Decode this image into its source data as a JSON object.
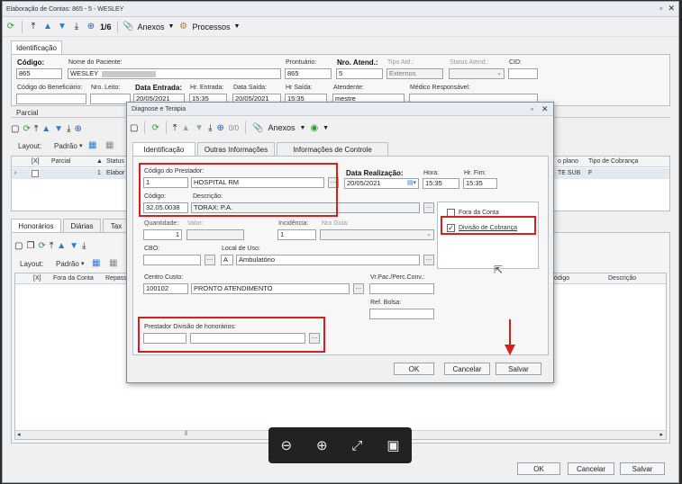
{
  "main": {
    "title": "Elaboração de Contas: 865 - 5 - WESLEY",
    "pager": "1/6",
    "anexos": "Anexos",
    "processos": "Processos",
    "tab_identificacao": "Identificação",
    "codigo_label": "Código:",
    "codigo_value": "865",
    "nome_label": "Nome do Paciente:",
    "nome_value": "WESLEY",
    "prontuario_label": "Prontuário:",
    "prontuario_value": "865",
    "nro_atend_label": "Nro. Atend.:",
    "nro_atend_value": "5",
    "tipo_atd_label": "Tipo Atd.:",
    "tipo_atd_value": "Externos",
    "status_atend_label": "Status Atend.:",
    "cid_label": "CID:",
    "cod_benef_label": "Código do Beneficiário:",
    "nro_leito_label": "Nro. Leito:",
    "data_entrada_label": "Data Entrada:",
    "data_entrada_value": "20/05/2021",
    "hr_entrada_label": "Hr. Entrada:",
    "hr_entrada_value": "15:35",
    "data_saida_label": "Data Saída:",
    "data_saida_value": "20/05/2021",
    "hr_saida_label": "Hr Saída:",
    "hr_saida_value": "15:35",
    "atendente_label": "Atendente:",
    "atendente_value": "mestre",
    "medico_label": "Médico Responsável:",
    "parcial_label": "Parcial",
    "layout_label": "Layout:",
    "padrao_label": "Padrão",
    "grid1": {
      "col_x": "[X]",
      "col_parcial": "Parcial",
      "col_status": "Status",
      "row_num": "1",
      "row_status": "Elabor"
    },
    "right_grid": {
      "col_plano": "o plano",
      "col_tipo": "Tipo de Cobrança",
      "row_plano": "TE SUB",
      "row_tipo": "F"
    },
    "tabs2": [
      "Honorários",
      "Diárias",
      "Tax"
    ],
    "grid2": {
      "col_x": "[X]",
      "col_fora": "Fora da Conta",
      "col_repass": "Repass",
      "col_codigo": "ódigo",
      "col_descricao": "Descrição"
    },
    "btn_ok": "OK",
    "btn_cancelar": "Cancelar",
    "btn_salvar": "Salvar"
  },
  "dialog": {
    "title": "Diagnose e Terapia",
    "pager": "0/0",
    "anexos": "Anexos",
    "tabs": [
      "Identificação",
      "Outras Informações",
      "Informações de Controle"
    ],
    "cod_prestador_label": "Código do Prestador:",
    "cod_prestador_value": "1",
    "prestador_nome": "HOSPITAL RM",
    "codigo_label": "Código:",
    "codigo_value": "32.05.0038",
    "descricao_label": "Descrição:",
    "descricao_value": "TORAX: P.A.",
    "data_realizacao_label": "Data Realização:",
    "data_realizacao_value": "20/05/2021",
    "hora_label": "Hora:",
    "hora_value": "15:35",
    "hr_fim_label": "Hr. Fim:",
    "hr_fim_value": "15:35",
    "quantidade_label": "Quantidade:",
    "quantidade_value": "1",
    "valor_label": "Valor:",
    "incidencia_label": "Incidência:",
    "incidencia_value": "1",
    "nro_guia_label": "Nro Guia:",
    "cbo_label": "CBO:",
    "local_uso_label": "Local de Uso:",
    "local_uso_code": "A",
    "local_uso_value": "Ambulatório",
    "centro_custo_label": "Centro Custo:",
    "centro_custo_code": "100102",
    "centro_custo_value": "PRONTO ATENDIMENTO",
    "vr_pac_label": "Vr.Pac./Perc.Conv.:",
    "ref_bolsa_label": "Ref. Bolsa:",
    "prest_div_label": "Prestador Divisão de honorários:",
    "fora_conta_label": "Fora da Conta",
    "divisao_cobranca_label": "Divisão de Cobrança",
    "btn_ok": "OK",
    "btn_cancelar": "Cancelar",
    "btn_salvar": "Salvar"
  },
  "colors": {
    "highlight": "#d42020",
    "accent": "#2a7ad6"
  }
}
